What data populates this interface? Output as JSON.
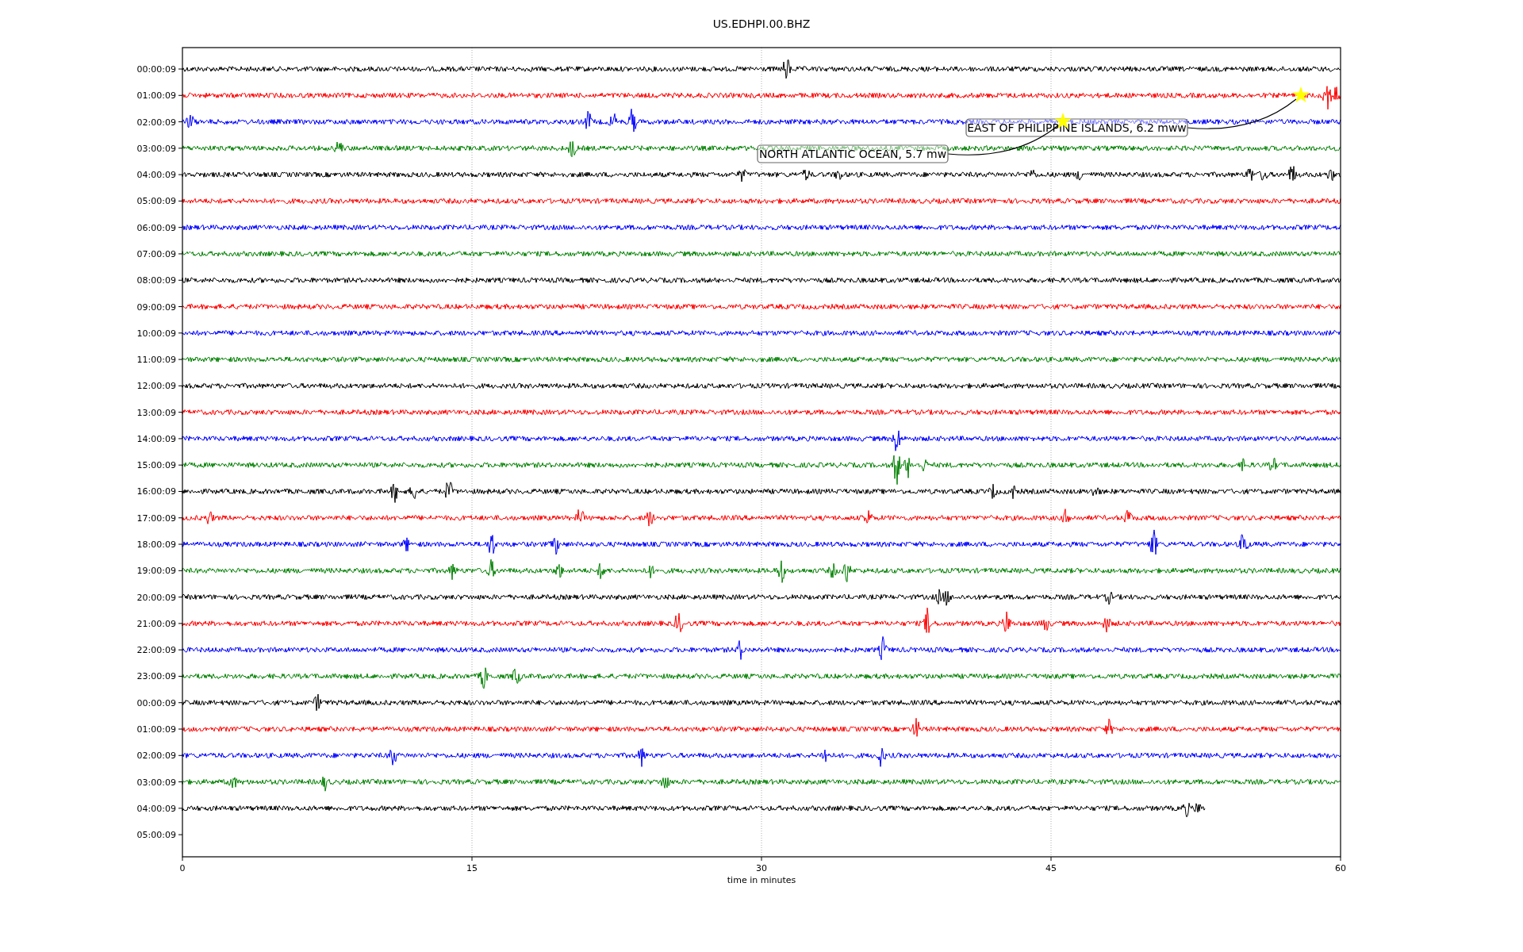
{
  "title": "US.EDHPI.00.BHZ",
  "rows": [
    {
      "label": "00:00:09",
      "color": "#000000",
      "kind": "full"
    },
    {
      "label": "01:00:09",
      "color": "#ff0000",
      "kind": "full"
    },
    {
      "label": "02:00:09",
      "color": "#0000ff",
      "kind": "full"
    },
    {
      "label": "03:00:09",
      "color": "#008000",
      "kind": "full"
    },
    {
      "label": "04:00:09",
      "color": "#000000",
      "kind": "full"
    },
    {
      "label": "05:00:09",
      "color": "#ff0000",
      "kind": "full"
    },
    {
      "label": "06:00:09",
      "color": "#0000ff",
      "kind": "full"
    },
    {
      "label": "07:00:09",
      "color": "#008000",
      "kind": "full"
    },
    {
      "label": "08:00:09",
      "color": "#000000",
      "kind": "full"
    },
    {
      "label": "09:00:09",
      "color": "#ff0000",
      "kind": "full"
    },
    {
      "label": "10:00:09",
      "color": "#0000ff",
      "kind": "full"
    },
    {
      "label": "11:00:09",
      "color": "#008000",
      "kind": "full"
    },
    {
      "label": "12:00:09",
      "color": "#000000",
      "kind": "full"
    },
    {
      "label": "13:00:09",
      "color": "#ff0000",
      "kind": "full"
    },
    {
      "label": "14:00:09",
      "color": "#0000ff",
      "kind": "full"
    },
    {
      "label": "15:00:09",
      "color": "#008000",
      "kind": "full"
    },
    {
      "label": "16:00:09",
      "color": "#000000",
      "kind": "full"
    },
    {
      "label": "17:00:09",
      "color": "#ff0000",
      "kind": "full"
    },
    {
      "label": "18:00:09",
      "color": "#0000ff",
      "kind": "full"
    },
    {
      "label": "19:00:09",
      "color": "#008000",
      "kind": "full"
    },
    {
      "label": "20:00:09",
      "color": "#000000",
      "kind": "full"
    },
    {
      "label": "21:00:09",
      "color": "#ff0000",
      "kind": "full"
    },
    {
      "label": "22:00:09",
      "color": "#0000ff",
      "kind": "full"
    },
    {
      "label": "23:00:09",
      "color": "#008000",
      "kind": "full"
    },
    {
      "label": "00:00:09",
      "color": "#000000",
      "kind": "full"
    },
    {
      "label": "01:00:09",
      "color": "#ff0000",
      "kind": "full"
    },
    {
      "label": "02:00:09",
      "color": "#0000ff",
      "kind": "full"
    },
    {
      "label": "03:00:09",
      "color": "#008000",
      "kind": "full"
    },
    {
      "label": "04:00:09",
      "color": "#000000",
      "kind": "partial"
    },
    {
      "label": "05:00:09",
      "kind": "none"
    }
  ],
  "x_ticks": [
    "0",
    "15",
    "30",
    "45",
    "60"
  ],
  "xlabel": "time in minutes",
  "annotations": [
    {
      "text": "EAST OF PHILIPPINE ISLANDS, 6.2 mww"
    },
    {
      "text": "NORTH ATLANTIC OCEAN, 5.7 mw"
    }
  ]
}
